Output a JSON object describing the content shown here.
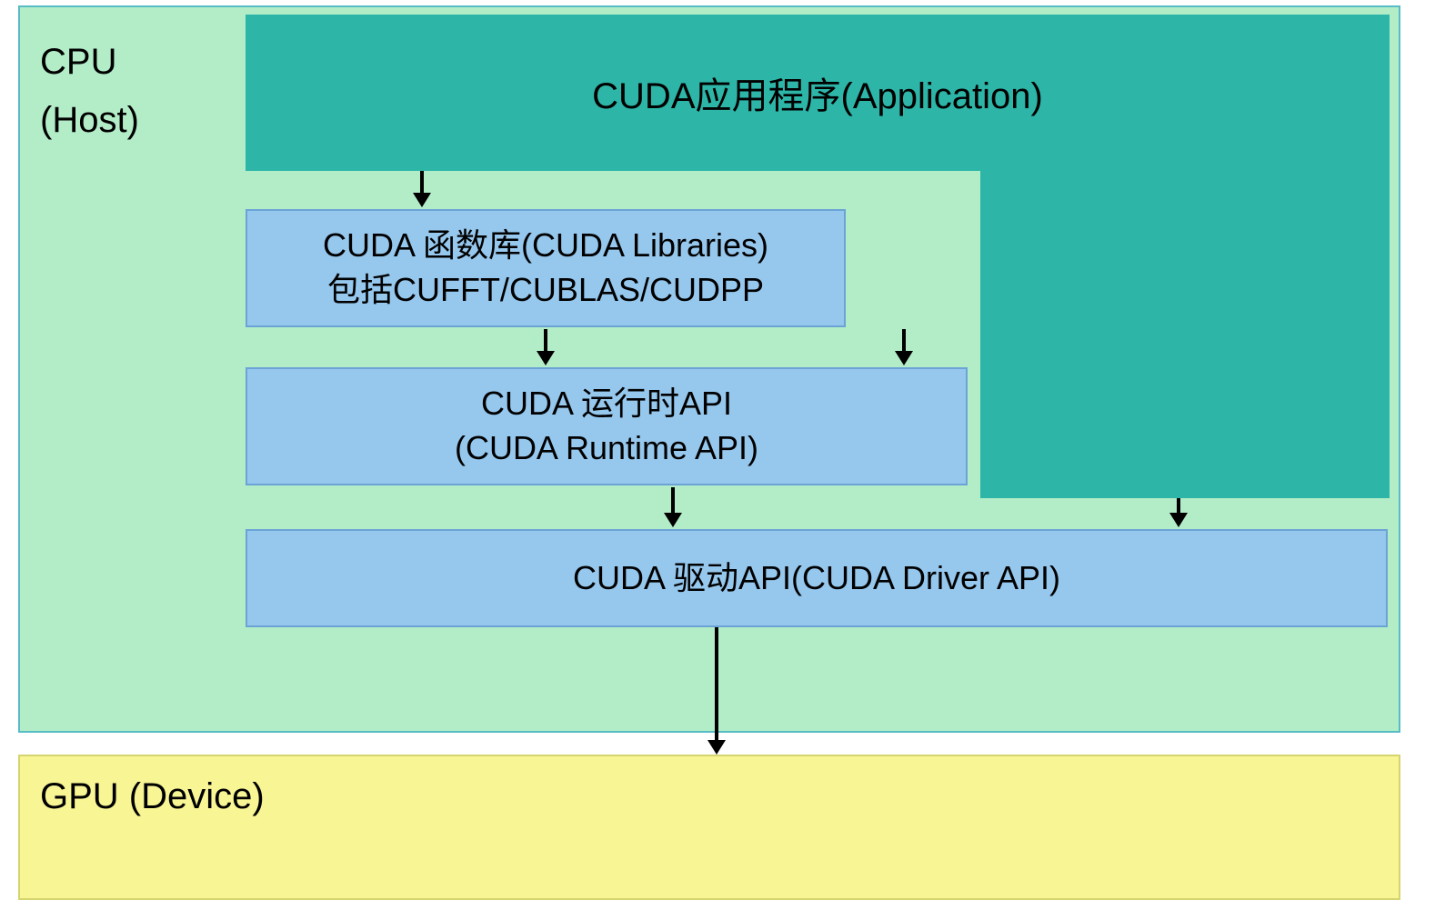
{
  "cpu": {
    "label_line1": "CPU",
    "label_line2": "(Host)"
  },
  "application": {
    "label": "CUDA应用程序(Application)"
  },
  "libraries": {
    "line1": "CUDA 函数库(CUDA Libraries)",
    "line2": "包括CUFFT/CUBLAS/CUDPP"
  },
  "runtime": {
    "line1": "CUDA 运行时API",
    "line2": "(CUDA Runtime API)"
  },
  "driver": {
    "label": "CUDA 驱动API(CUDA Driver API)"
  },
  "gpu": {
    "label": "GPU (Device)"
  },
  "colors": {
    "cpu_bg": "#b3edc8",
    "teal": "#2db6a8",
    "blue": "#96c7ed",
    "gpu_bg": "#f8f595"
  }
}
